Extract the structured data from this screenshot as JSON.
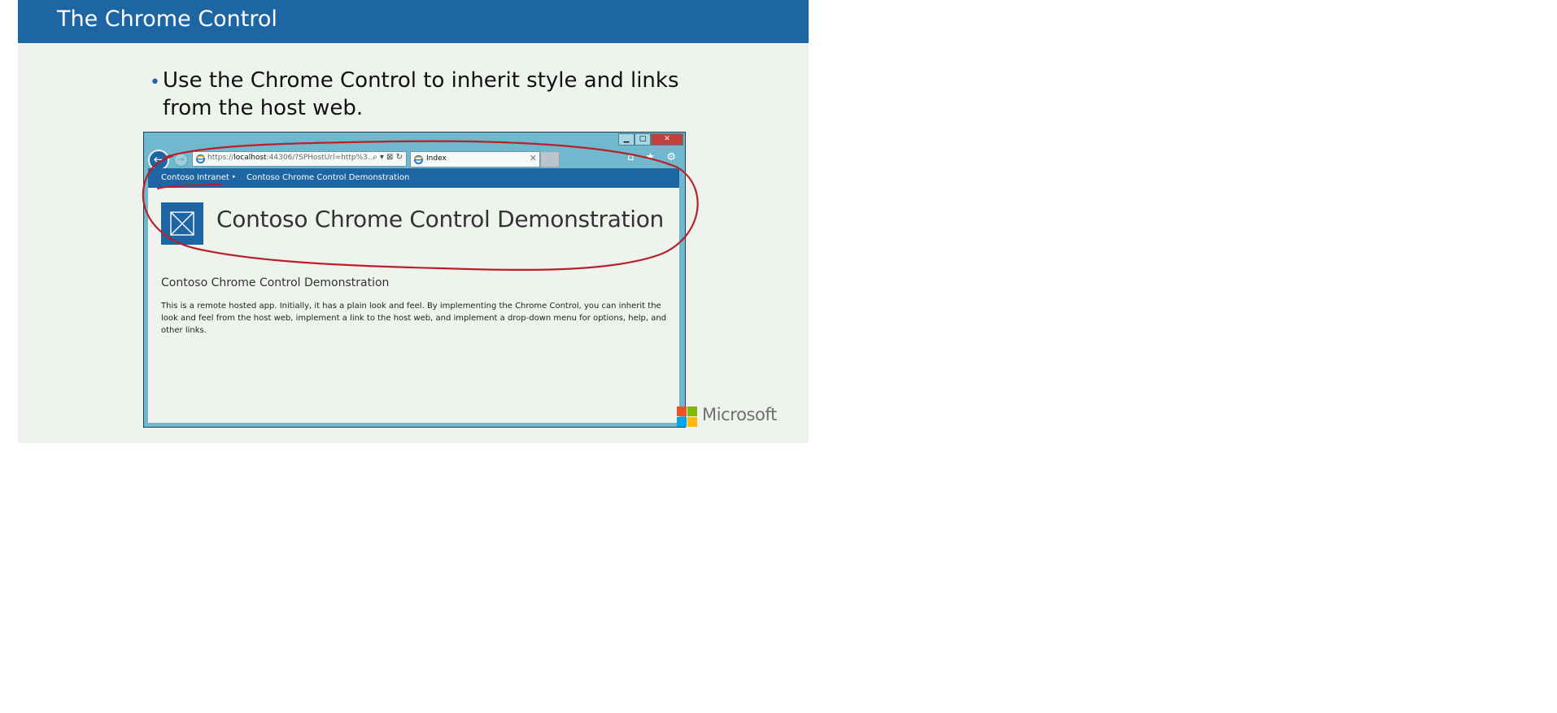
{
  "slide": {
    "title": "The Chrome Control",
    "bullet_marker": "•",
    "bullet": "Use the Chrome Control to inherit style and links from the host web."
  },
  "browser": {
    "url_prefix": "https://",
    "url_host": "localhost",
    "url_rest": ":44306/?SPHostUrl=http%3...",
    "address_tools": "⌕ ▾ ⊠ ↻",
    "tab_label": "Index",
    "tab_close": "✕",
    "back_glyph": "←",
    "forward_glyph": "→",
    "window_buttons": {
      "minimize": "▁",
      "maximize": "□",
      "close": "✕"
    },
    "toolbar_icons": "⌂ ★ ⚙",
    "icons": [
      "back-arrow-icon",
      "forward-arrow-icon",
      "ie-icon",
      "search-icon",
      "dropdown-icon",
      "compat-view-icon",
      "refresh-icon",
      "home-icon",
      "favorites-star-icon",
      "settings-gear-icon"
    ]
  },
  "app_page": {
    "breadcrumb": [
      "Contoso Intranet",
      "Contoso Chrome Control Demonstration"
    ],
    "breadcrumb_separator": "▸",
    "site_title": "Contoso Chrome Control Demonstration",
    "heading": "Contoso Chrome Control Demonstration",
    "body": "This is a remote hosted app. Initially, it has a plain look and feel. By implementing the Chrome Control, you can inherit the look and feel from the host web, implement a link to the host web, and implement a drop-down menu for options, help, and other links."
  },
  "branding": {
    "company": "Microsoft"
  },
  "colors": {
    "accent": "#1e65a4",
    "slide_background": "#eff3ee",
    "annotation": "#b8202a",
    "ms_red": "#f25022",
    "ms_green": "#7fba00",
    "ms_blue": "#00a4ef",
    "ms_yellow": "#ffb900"
  }
}
